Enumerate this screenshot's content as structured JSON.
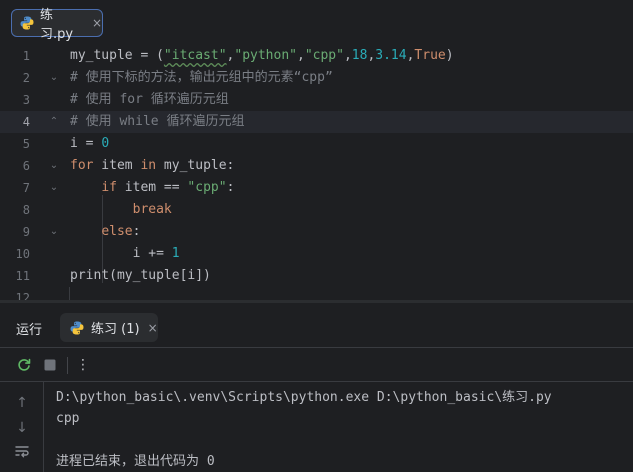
{
  "editor_tab": {
    "label": "练习.py",
    "close": "×",
    "icon": "python-file-icon"
  },
  "code_lines": [
    {
      "n": "1"
    },
    {
      "n": "2",
      "text": "# 使用下标的方法，输出元组中的元素“cpp”"
    },
    {
      "n": "3",
      "text": "# 使用 for 循环遍历元组"
    },
    {
      "n": "4",
      "text": "# 使用 while 循环遍历元组"
    },
    {
      "n": "5"
    },
    {
      "n": "6"
    },
    {
      "n": "7"
    },
    {
      "n": "8"
    },
    {
      "n": "9"
    },
    {
      "n": "10"
    },
    {
      "n": "11"
    },
    {
      "n": "12"
    }
  ],
  "tokens": {
    "l1": [
      "my_tuple = (",
      "\"itcast\"",
      ",",
      "\"python\"",
      ",",
      "\"cpp\"",
      ",",
      "18",
      ",",
      "3.14",
      ",",
      "True",
      ")"
    ],
    "l5": [
      "i = ",
      "0"
    ],
    "l6": [
      "for",
      " item ",
      "in",
      " my_tuple:"
    ],
    "l7": [
      "    ",
      "if",
      " item == ",
      "\"cpp\"",
      ":"
    ],
    "l8": [
      "        ",
      "break"
    ],
    "l9": [
      "    ",
      "else",
      ":"
    ],
    "l10": [
      "        i += ",
      "1"
    ],
    "l11": [
      "print",
      "(my_tuple[i])"
    ]
  },
  "run_window": {
    "title": "运行",
    "tab_label": "练习 (1)",
    "tab_close": "×",
    "toolbar": {
      "rerun": "rerun-icon",
      "stop": "stop-icon",
      "more": "⋮"
    },
    "side": {
      "up": "↑",
      "down": "↓",
      "wrap": "soft-wrap-icon"
    },
    "console": [
      "D:\\python_basic\\.venv\\Scripts\\python.exe D:\\python_basic\\练习.py",
      "cpp",
      "",
      "进程已结束，退出代码为 0"
    ]
  },
  "colors": {
    "background": "#1e1f22",
    "keyword": "#cf8e6d",
    "string": "#6aab73",
    "number": "#2aacb8",
    "comment": "#7a7e85",
    "accent": "#4b6eaf"
  }
}
